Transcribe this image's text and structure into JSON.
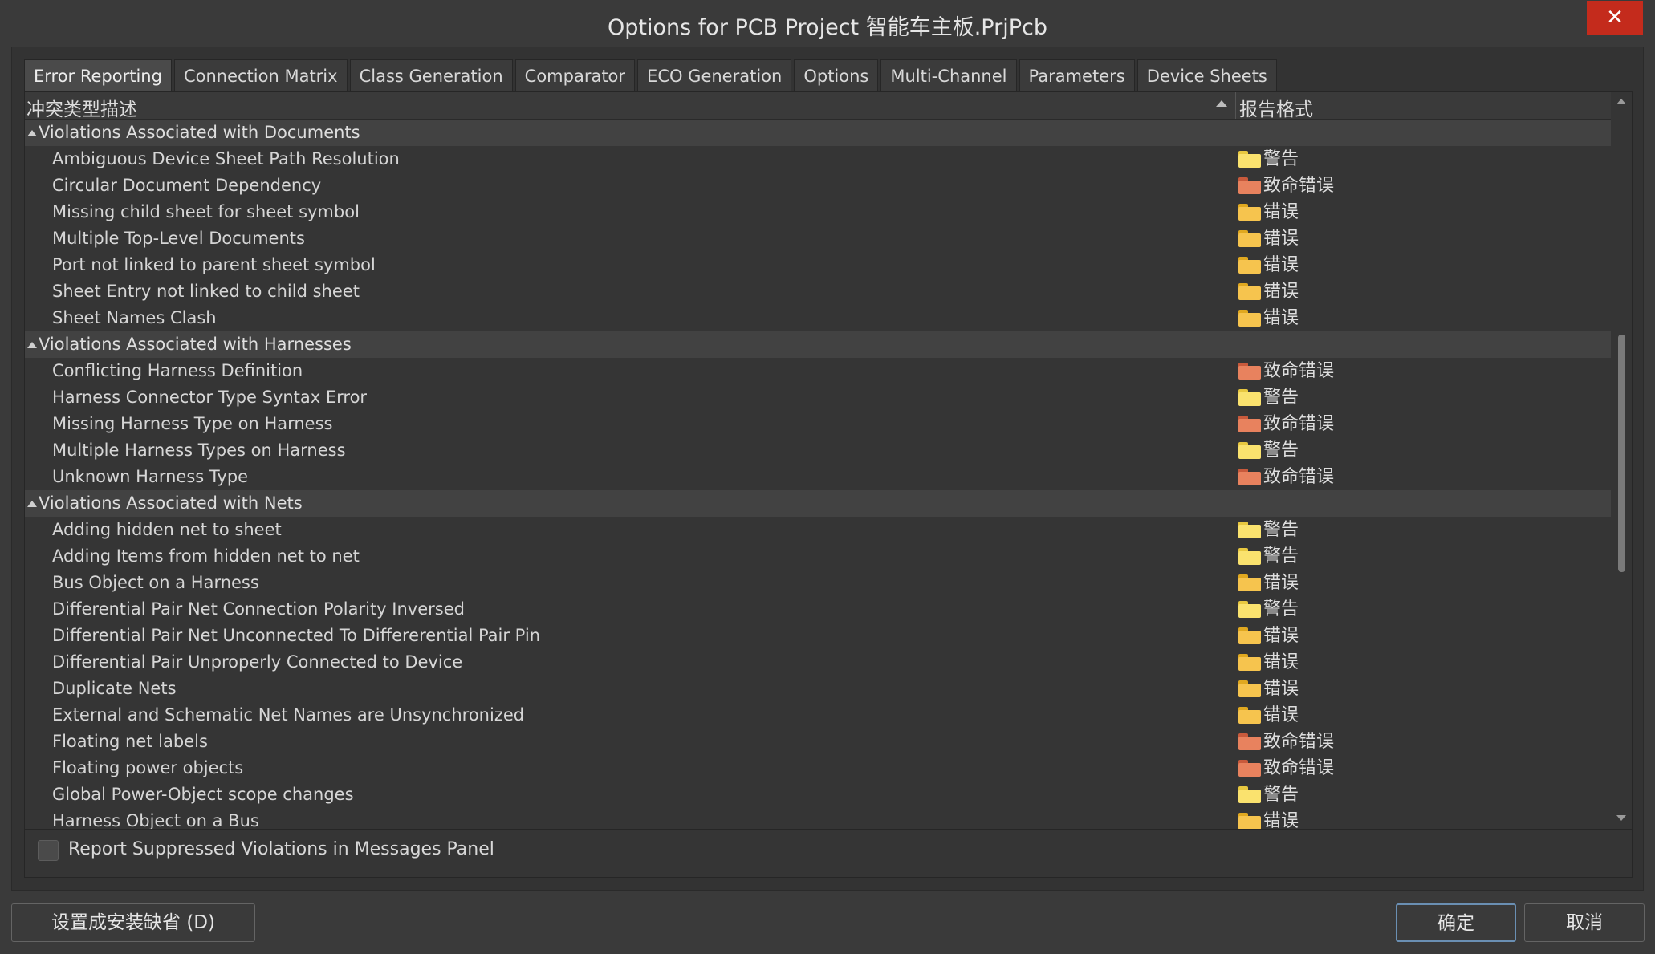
{
  "window": {
    "title": "Options for PCB Project 智能车主板.PrjPcb",
    "close_label": "✕"
  },
  "tabs": [
    {
      "label": "Error Reporting",
      "active": true
    },
    {
      "label": "Connection Matrix"
    },
    {
      "label": "Class Generation"
    },
    {
      "label": "Comparator"
    },
    {
      "label": "ECO Generation"
    },
    {
      "label": "Options"
    },
    {
      "label": "Multi-Channel"
    },
    {
      "label": "Parameters"
    },
    {
      "label": "Device Sheets"
    }
  ],
  "grid": {
    "columns": {
      "type": "冲突类型描述",
      "format": "报告格式"
    },
    "rows": [
      {
        "kind": "group",
        "label": "Violations Associated with Documents"
      },
      {
        "kind": "item",
        "label": "Ambiguous Device Sheet Path Resolution",
        "status": "警告",
        "level": "warn"
      },
      {
        "kind": "item",
        "label": "Circular Document Dependency",
        "status": "致命错误",
        "level": "fatal"
      },
      {
        "kind": "item",
        "label": "Missing child sheet for sheet symbol",
        "status": "错误",
        "level": "error"
      },
      {
        "kind": "item",
        "label": "Multiple Top-Level Documents",
        "status": "错误",
        "level": "error"
      },
      {
        "kind": "item",
        "label": "Port not linked to parent sheet symbol",
        "status": "错误",
        "level": "error"
      },
      {
        "kind": "item",
        "label": "Sheet Entry not linked to child sheet",
        "status": "错误",
        "level": "error"
      },
      {
        "kind": "item",
        "label": "Sheet Names Clash",
        "status": "错误",
        "level": "error"
      },
      {
        "kind": "group",
        "label": "Violations Associated with Harnesses"
      },
      {
        "kind": "item",
        "label": "Conflicting Harness Definition",
        "status": "致命错误",
        "level": "fatal"
      },
      {
        "kind": "item",
        "label": "Harness Connector Type Syntax Error",
        "status": "警告",
        "level": "warn"
      },
      {
        "kind": "item",
        "label": "Missing Harness Type on Harness",
        "status": "致命错误",
        "level": "fatal"
      },
      {
        "kind": "item",
        "label": "Multiple Harness Types on Harness",
        "status": "警告",
        "level": "warn"
      },
      {
        "kind": "item",
        "label": "Unknown Harness Type",
        "status": "致命错误",
        "level": "fatal"
      },
      {
        "kind": "group",
        "label": "Violations Associated with Nets"
      },
      {
        "kind": "item",
        "label": "Adding hidden net to sheet",
        "status": "警告",
        "level": "warn"
      },
      {
        "kind": "item",
        "label": "Adding Items from hidden net to net",
        "status": "警告",
        "level": "warn"
      },
      {
        "kind": "item",
        "label": "Bus Object on a Harness",
        "status": "错误",
        "level": "error"
      },
      {
        "kind": "item",
        "label": "Differential Pair Net Connection Polarity Inversed",
        "status": "警告",
        "level": "warn"
      },
      {
        "kind": "item",
        "label": "Differential Pair Net Unconnected To Differerential Pair Pin",
        "status": "错误",
        "level": "error"
      },
      {
        "kind": "item",
        "label": "Differential Pair Unproperly Connected to Device",
        "status": "错误",
        "level": "error"
      },
      {
        "kind": "item",
        "label": "Duplicate Nets",
        "status": "错误",
        "level": "error"
      },
      {
        "kind": "item",
        "label": "External and Schematic Net Names are Unsynchronized",
        "status": "错误",
        "level": "error"
      },
      {
        "kind": "item",
        "label": "Floating net labels",
        "status": "致命错误",
        "level": "fatal"
      },
      {
        "kind": "item",
        "label": "Floating power objects",
        "status": "致命错误",
        "level": "fatal"
      },
      {
        "kind": "item",
        "label": "Global Power-Object scope changes",
        "status": "警告",
        "level": "warn"
      },
      {
        "kind": "item",
        "label": "Harness Object on a Bus",
        "status": "错误",
        "level": "error"
      }
    ]
  },
  "footer": {
    "checkbox_label": "Report Suppressed Violations in Messages Panel",
    "checked": false
  },
  "buttons": {
    "defaults": "设置成安装缺省 (D)",
    "ok": "确定",
    "cancel": "取消"
  },
  "colors": {
    "close": "#c42b1c",
    "warn_folder": "#fae26e",
    "error_folder": "#f6c44e",
    "fatal_folder": "#e8825e"
  }
}
